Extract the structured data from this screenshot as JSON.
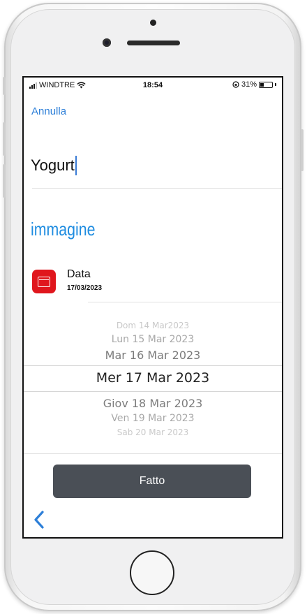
{
  "status_bar": {
    "carrier": "WINDTRE",
    "time": "18:54",
    "battery": "31%",
    "battery_level": 0.31
  },
  "nav": {
    "cancel_label": "Annulla"
  },
  "item": {
    "name": "Yogurt"
  },
  "image_link": "immagine",
  "date_field": {
    "label": "Data",
    "value": "17/03/2023"
  },
  "picker": {
    "options": [
      "Dom 14 Mar2023",
      "Lun 15 Mar 2023",
      "Mar 16 Mar 2023",
      "Mer 17 Mar 2023",
      "Giov 18 Mar 2023",
      "Ven 19 Mar 2023",
      "Sab 20 Mar 2023"
    ],
    "selected": "Mer 17 Mar 2023"
  },
  "done_label": "Fatto",
  "icons": {
    "back": "chevron-left-icon",
    "calendar": "calendar-icon",
    "wifi": "wifi-icon",
    "signal": "signal-icon",
    "battery": "battery-icon",
    "lock_rotation": "orientation-lock-icon"
  },
  "colors": {
    "accent_blue": "#2d7fd8",
    "calendar_red": "#e0161d",
    "done_button": "#4a4f56"
  }
}
